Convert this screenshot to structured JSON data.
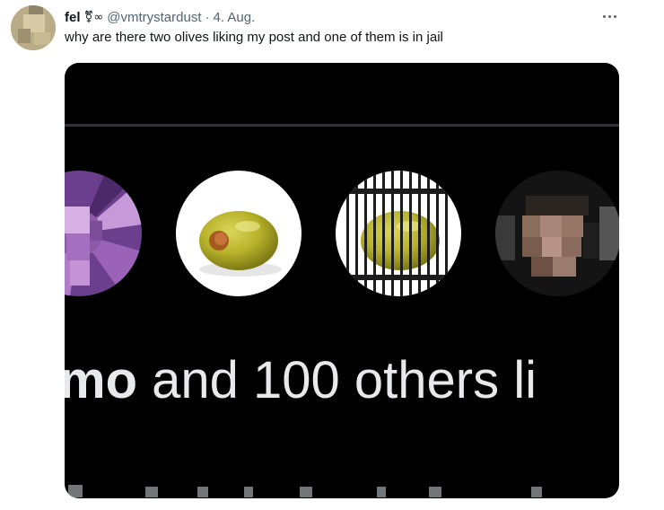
{
  "tweet": {
    "display_name": "fel",
    "badge": "⚧∞",
    "handle": "@vmtrystardust",
    "separator": "·",
    "date": "4. Aug.",
    "text": "why are there two olives liking my post and one of them is in jail",
    "more_icon": "more-horizontal-icon"
  },
  "screenshot": {
    "liked_by_prefix": "mo",
    "liked_by_rest": " and 100 others li",
    "avatars": [
      "pixelated-purple-avatar",
      "olive-avatar",
      "olive-in-jail-avatar",
      "pixelated-person-avatar"
    ]
  },
  "colors": {
    "text": "#0f1419",
    "secondary": "#536471",
    "media_bg": "#000000",
    "olive": "#b8b22a"
  }
}
